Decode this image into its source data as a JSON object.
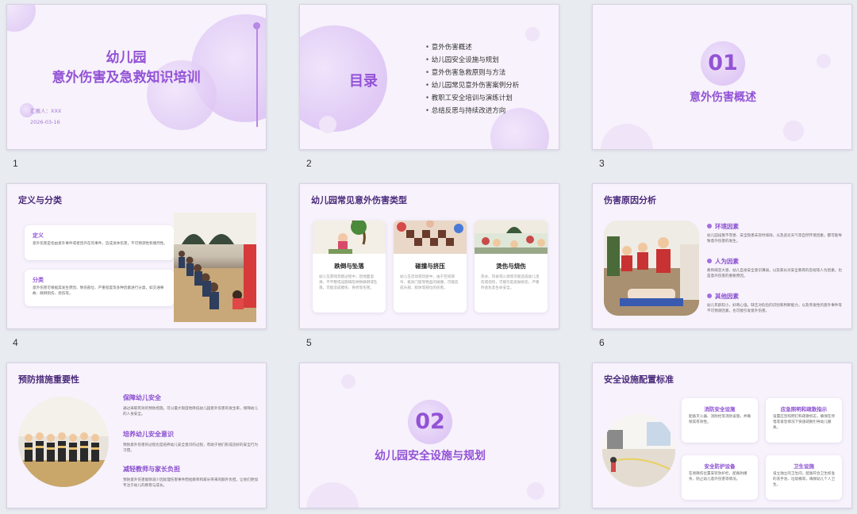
{
  "slides": [
    {
      "number": "1",
      "title_line1": "幼儿园",
      "title_line2": "意外伤害及急救知识培训",
      "reporter": "汇报人：XXX",
      "date": "2026-03-16"
    },
    {
      "number": "2",
      "heading": "目录",
      "items": [
        "意外伤害概述",
        "幼儿园安全设施与规划",
        "意外伤害急救原则与方法",
        "幼儿园常见意外伤害案例分析",
        "教职工安全培训与演练计划",
        "总结反思与持续改进方向"
      ]
    },
    {
      "number": "3",
      "section_no": "01",
      "section_title": "意外伤害概述"
    },
    {
      "number": "4",
      "heading": "定义与分类",
      "card1_title": "定义",
      "card1_text": "意外伤害是指由意外事件或者因外在的事件，造成身体伤害，不可预测性和偶然性。",
      "card2_title": "分类",
      "card2_text": "意外伤害可根据其发生原因、致伤部位、严重程度等多种因素进行分类，如交通事故、跌倒损伤、烧伤等。"
    },
    {
      "number": "5",
      "heading": "幼儿园常见意外伤害类型",
      "cards": [
        {
          "title": "跌倒与坠落",
          "text": "幼儿在游戏奔跑过程中，因地面湿滑、不平整或设施缺陷导致跌倒或坠落，可能造成擦伤、骨折等伤害。"
        },
        {
          "title": "碰撞与挤压",
          "text": "幼儿在活动或玩耍中，由于空间狭窄、家具门窗等物品的碰撞，可能造成头部、肢体等部位的伤害。"
        },
        {
          "title": "烫伤与烧伤",
          "text": "热水、热食或火源等可能造成幼儿烫伤或烧伤，可能引起皮肤损伤，严重时会危及生命安全。"
        }
      ]
    },
    {
      "number": "6",
      "heading": "伤害原因分析",
      "items": [
        {
          "title": "环境因素",
          "text": "幼儿园设施不完善、安全隐患未及时排除，以及恶劣天气等自然环境因素，都可能导致意外伤害的发生。"
        },
        {
          "title": "人为因素",
          "text": "教师疏忽大意、幼儿自身安全意识薄弱，以及家长对安全教育的忽视等人为因素，也是意外伤害的重要原因。"
        },
        {
          "title": "其他因素",
          "text": "幼儿年龄较小，好奇心强，缺乏对危险的识别和判断能力，以及突发性的意外事件等不可预测因素，也可能引发意外伤害。"
        }
      ]
    },
    {
      "number": "7",
      "heading": "预防措施重要性",
      "items": [
        {
          "title": "保障幼儿安全",
          "text": "通过采取有效的预防措施，可以最大限度地降低幼儿园意外伤害的发生率，保障幼儿的人身安全。"
        },
        {
          "title": "培养幼儿安全意识",
          "text": "预防意外伤害的过程也是培养幼儿安全意识的过程，有助于他们形成良好的安全行为习惯。"
        },
        {
          "title": "减轻教师与家长负担",
          "text": "预防意外伤害能够减少因处理伤害事件而给教师和家长带来的额外负担，让他们更加专注于幼儿的教育与成长。"
        }
      ]
    },
    {
      "number": "8",
      "section_no": "02",
      "section_title": "幼儿园安全设施与规划"
    },
    {
      "number": "9",
      "heading": "安全设施配置标准",
      "cards": [
        {
          "title": "消防安全设施",
          "text": "配备灭火器、消防栓等消防设施，并确保其有效性。"
        },
        {
          "title": "应急照明和疏散指示",
          "text": "设置应急照明灯和疏散标志，确保在停电等紧急情况下快速疏散引导幼儿撤离。"
        },
        {
          "title": "安全防护设备",
          "text": "在易跌伤位置安装防护栏，配备防撞条，防止幼儿意外伤害等情况。"
        },
        {
          "title": "卫生设施",
          "text": "设立独立的卫生间，配备符合卫生标准的洗手池、垃圾桶等，确保幼儿个人卫生。"
        }
      ]
    }
  ]
}
